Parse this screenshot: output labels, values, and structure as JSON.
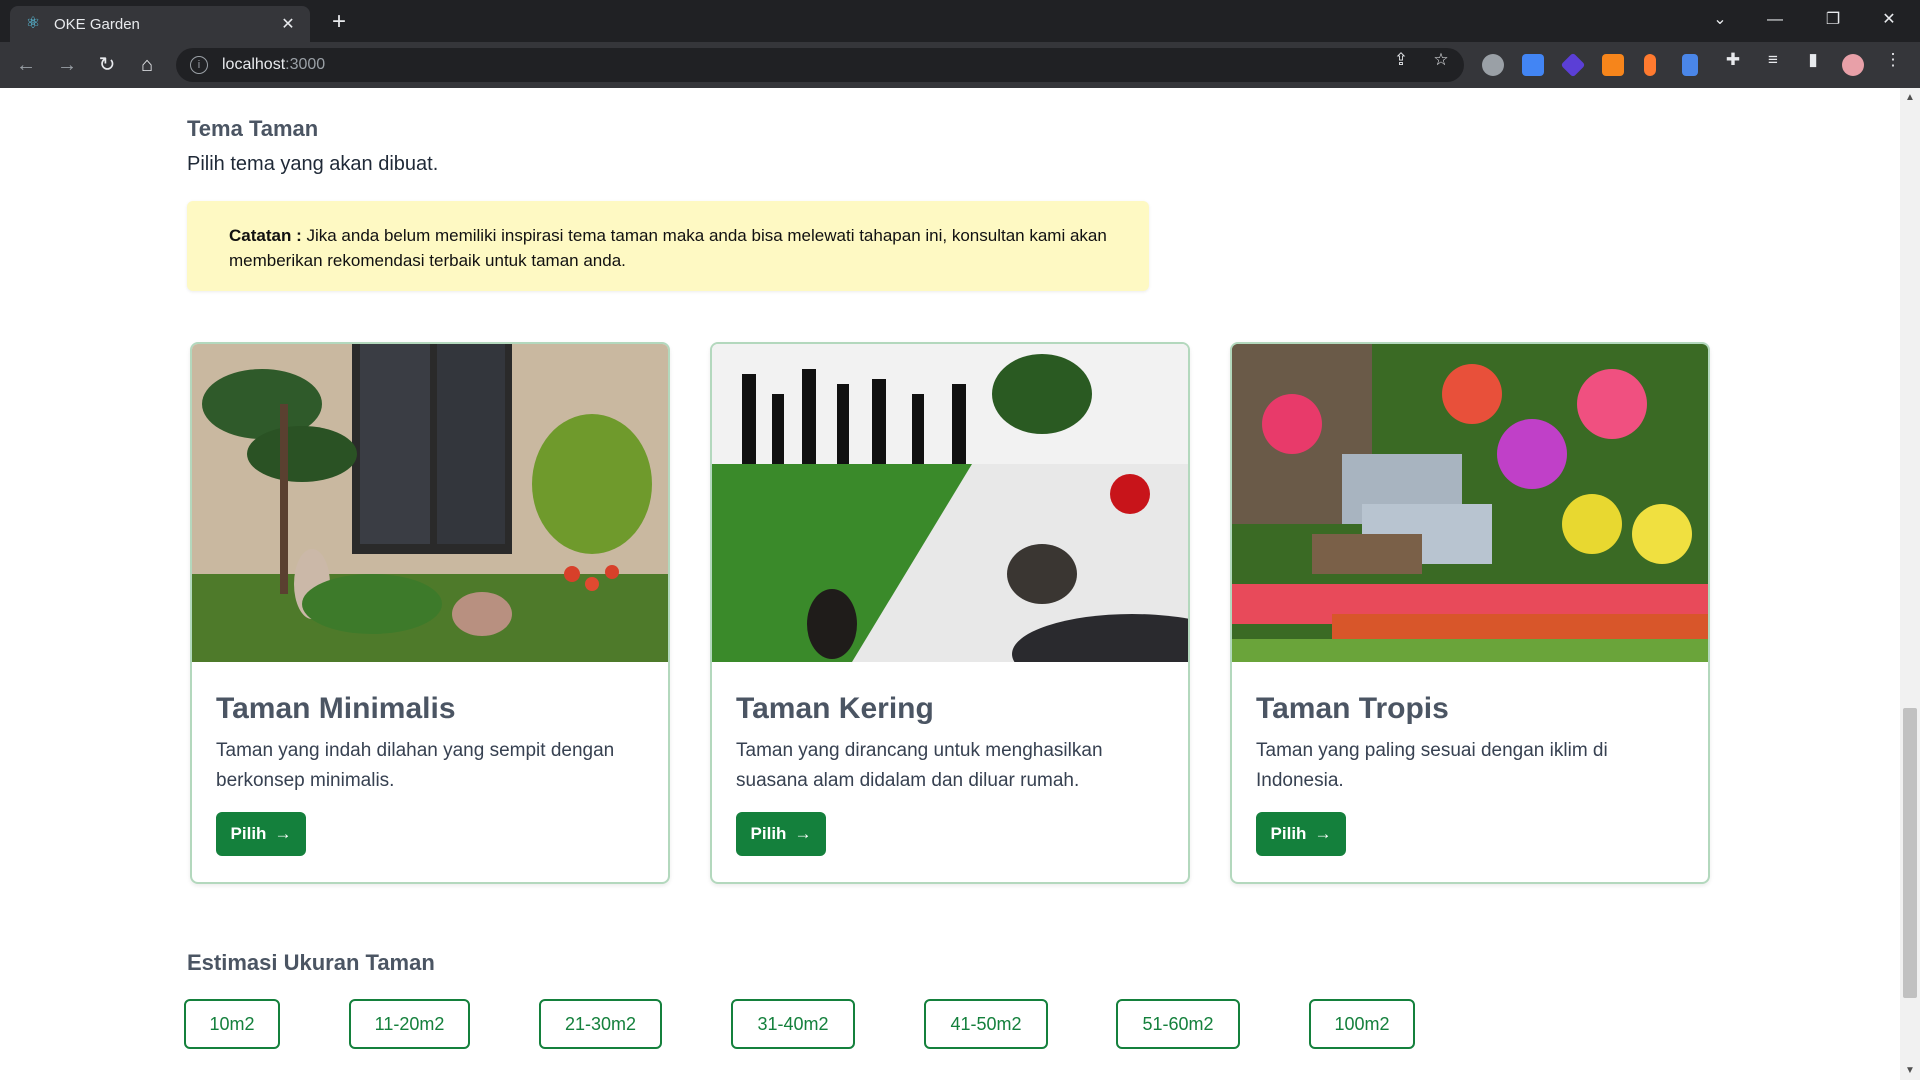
{
  "browser": {
    "tab_title": "OKE Garden",
    "url_host": "localhost",
    "url_port": ":3000"
  },
  "theme_section": {
    "title": "Tema Taman",
    "subtitle": "Pilih tema yang akan dibuat.",
    "note_label": "Catatan :",
    "note_text": " Jika anda belum memiliki inspirasi tema taman maka anda bisa melewati tahapan ini, konsultan kami akan memberikan rekomendasi terbaik untuk taman anda."
  },
  "cards": [
    {
      "title": "Taman Minimalis",
      "description": "Taman yang indah dilahan yang sempit dengan berkonsep minimalis.",
      "button": "Pilih"
    },
    {
      "title": "Taman Kering",
      "description": "Taman yang dirancang untuk menghasilkan suasana alam didalam dan diluar rumah.",
      "button": "Pilih"
    },
    {
      "title": "Taman Tropis",
      "description": "Taman yang paling sesuai dengan iklim di Indonesia.",
      "button": "Pilih"
    }
  ],
  "size_section": {
    "title": "Estimasi Ukuran Taman",
    "options": [
      "10m2",
      "11-20m2",
      "21-30m2",
      "31-40m2",
      "41-50m2",
      "51-60m2",
      "100m2"
    ]
  },
  "colors": {
    "primary_green": "#14803c",
    "note_bg": "#fef9c3",
    "chrome_dark": "#202124"
  }
}
